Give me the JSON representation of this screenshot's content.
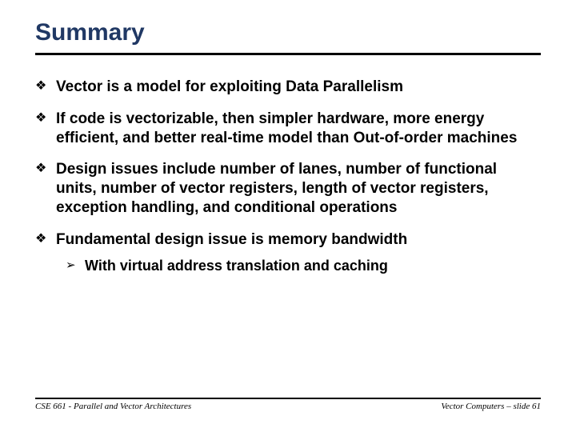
{
  "title": "Summary",
  "bullets": [
    "Vector is a model for exploiting Data Parallelism",
    "If code is vectorizable, then simpler hardware, more energy efficient, and better real-time model than Out-of-order machines",
    "Design issues include number of lanes, number of functional units, number of vector registers, length of vector registers, exception handling, and conditional operations",
    "Fundamental design issue is memory bandwidth"
  ],
  "sub_bullet": "With virtual address translation and caching",
  "footer_left": "CSE 661 - Parallel and Vector Architectures",
  "footer_right": "Vector Computers – slide 61"
}
